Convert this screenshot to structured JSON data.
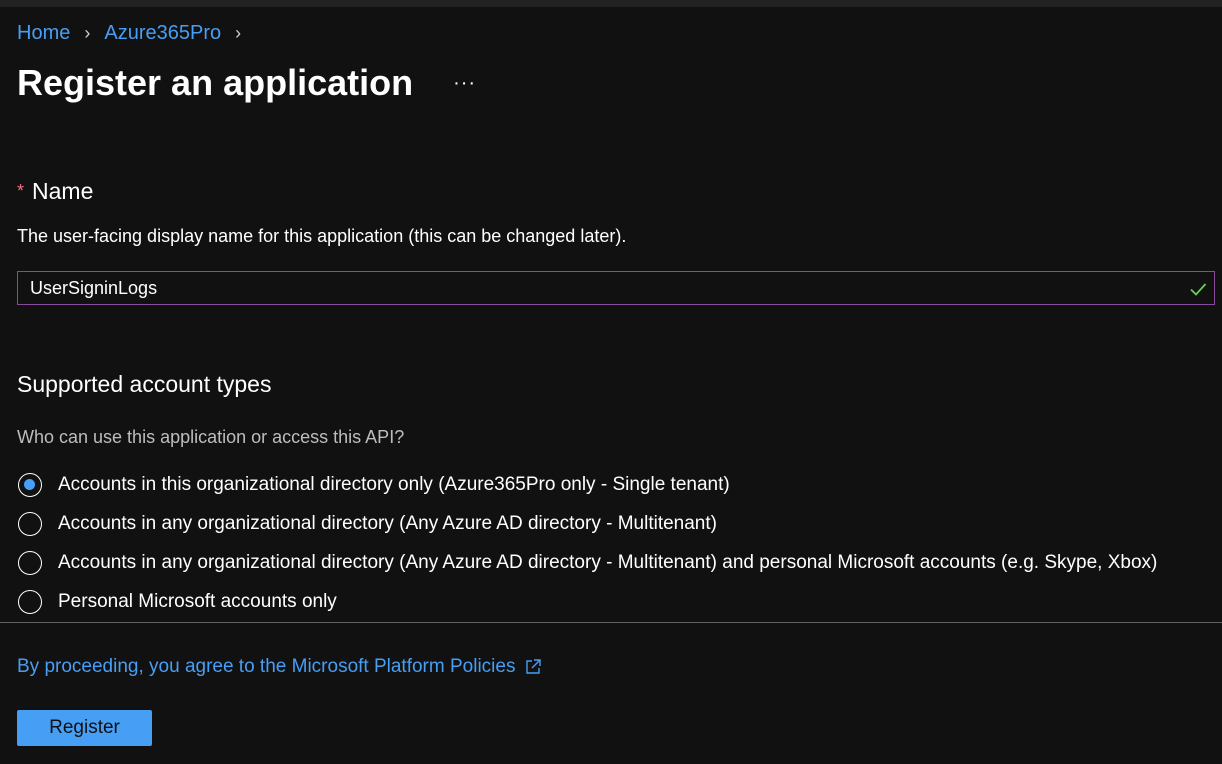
{
  "breadcrumb": {
    "home": "Home",
    "tenant": "Azure365Pro",
    "separator": "›"
  },
  "page": {
    "title": "Register an application",
    "more_label": "···"
  },
  "name_section": {
    "required_marker": "*",
    "label": "Name",
    "description": "The user-facing display name for this application (this can be changed later).",
    "value": "UserSigninLogs"
  },
  "account_types": {
    "title": "Supported account types",
    "question": "Who can use this application or access this API?",
    "options": [
      {
        "label": "Accounts in this organizational directory only (Azure365Pro only - Single tenant)",
        "selected": true
      },
      {
        "label": "Accounts in any organizational directory (Any Azure AD directory - Multitenant)",
        "selected": false
      },
      {
        "label": "Accounts in any organizational directory (Any Azure AD directory - Multitenant) and personal Microsoft accounts (e.g. Skype, Xbox)",
        "selected": false
      },
      {
        "label": "Personal Microsoft accounts only",
        "selected": false
      }
    ]
  },
  "footer": {
    "policy_link": "By proceeding, you agree to the Microsoft Platform Policies",
    "register_label": "Register"
  },
  "colors": {
    "background": "#111111",
    "accent": "#479ef5",
    "input_border": "#8a4a9c",
    "valid_check": "#6ccb5f",
    "required": "#f1707b"
  }
}
